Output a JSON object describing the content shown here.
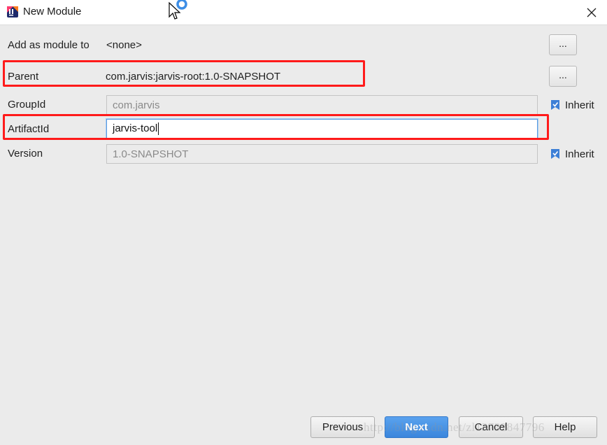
{
  "window": {
    "title": "New Module",
    "close_icon": "close-icon",
    "app_icon": "intellij-idea-icon"
  },
  "form": {
    "add_as_module_to": {
      "label": "Add as module to",
      "value": "<none>",
      "browse_label": "..."
    },
    "parent": {
      "label": "Parent",
      "value": "com.jarvis:jarvis-root:1.0-SNAPSHOT",
      "browse_label": "..."
    },
    "group_id": {
      "label": "GroupId",
      "value": "com.jarvis",
      "inherit_label": "Inherit",
      "inherit_checked": true
    },
    "artifact_id": {
      "label": "ArtifactId",
      "value": "jarvis-tool"
    },
    "version": {
      "label": "Version",
      "value": "1.0-SNAPSHOT",
      "inherit_label": "Inherit",
      "inherit_checked": true
    }
  },
  "footer": {
    "previous_label": "Previous",
    "next_label": "Next",
    "cancel_label": "Cancel",
    "help_label": "Help"
  },
  "watermark": "http://blog.csdn.net/zl13732847796",
  "colors": {
    "highlight": "#ff1a1a",
    "primary_button": "#3a86dc",
    "inherit_icon": "#3d7fd6",
    "background": "#ebebeb"
  }
}
